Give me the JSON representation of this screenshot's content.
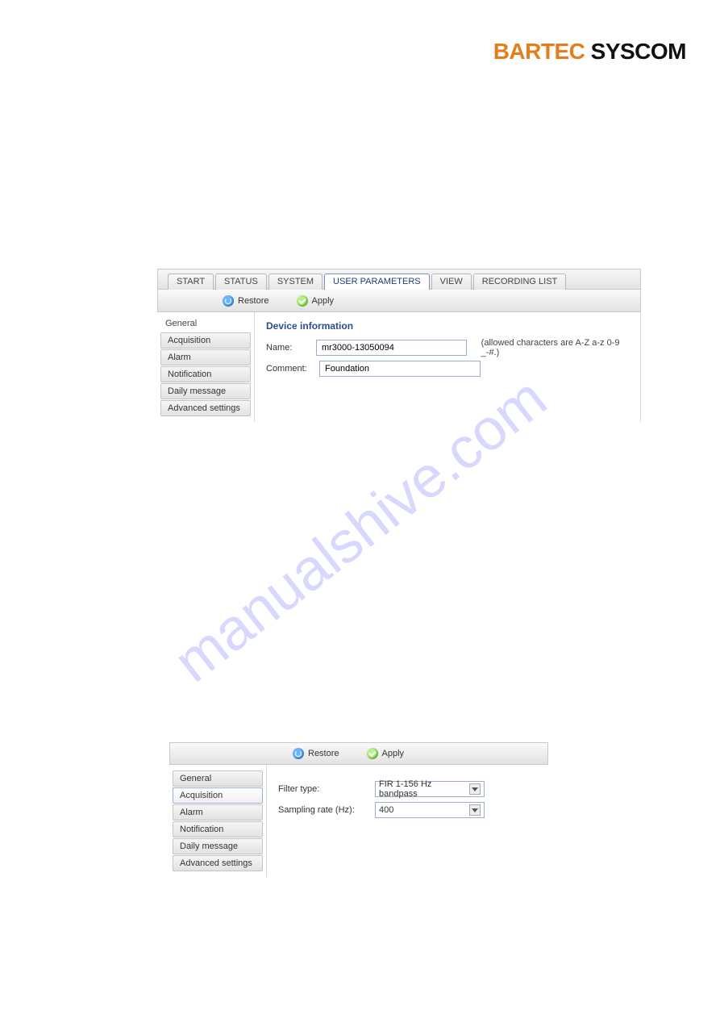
{
  "brand": {
    "part1": "BARTEC",
    "part2": "SYSCOM"
  },
  "watermark": "manualshive.com",
  "screenshot1": {
    "tabs": [
      "START",
      "STATUS",
      "SYSTEM",
      "USER PARAMETERS",
      "VIEW",
      "RECORDING LIST"
    ],
    "active_tab": "USER PARAMETERS",
    "toolbar": {
      "restore": "Restore",
      "apply": "Apply"
    },
    "side_title": "General",
    "side_items": [
      "Acquisition",
      "Alarm",
      "Notification",
      "Daily message",
      "Advanced settings"
    ],
    "section_title": "Device information",
    "name_label": "Name:",
    "name_value": "mr3000-13050094",
    "name_hint": "(allowed characters are A-Z a-z 0-9 _-#.)",
    "comment_label": "Comment:",
    "comment_value": "Foundation"
  },
  "screenshot2": {
    "toolbar": {
      "restore": "Restore",
      "apply": "Apply"
    },
    "side_items": [
      "General",
      "Acquisition",
      "Alarm",
      "Notification",
      "Daily message",
      "Advanced settings"
    ],
    "active_side": "Acquisition",
    "filter_label": "Filter type:",
    "filter_value": "FIR 1-156 Hz bandpass",
    "rate_label": "Sampling rate (Hz):",
    "rate_value": "400"
  }
}
